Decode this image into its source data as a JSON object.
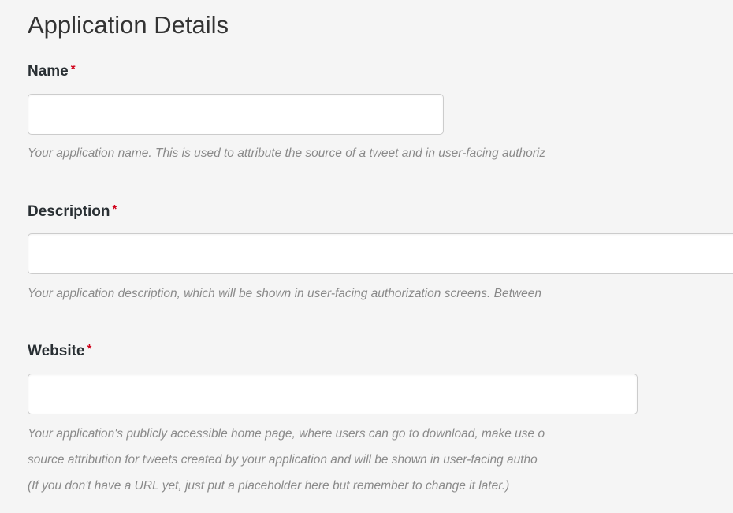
{
  "section": {
    "title": "Application Details"
  },
  "fields": {
    "name": {
      "label": "Name",
      "required_marker": "*",
      "value": "",
      "help": "Your application name. This is used to attribute the source of a tweet and in user-facing authoriz"
    },
    "description": {
      "label": "Description",
      "required_marker": "*",
      "value": "",
      "help": "Your application description, which will be shown in user-facing authorization screens. Between"
    },
    "website": {
      "label": "Website",
      "required_marker": "*",
      "value": "",
      "help_lines": [
        "Your application's publicly accessible home page, where users can go to download, make use o",
        "source attribution for tweets created by your application and will be shown in user-facing autho",
        "(If you don't have a URL yet, just put a placeholder here but remember to change it later.)"
      ]
    }
  },
  "colors": {
    "background": "#f5f5f5",
    "required": "#d0021b",
    "help_text": "#8a8a8a",
    "input_border": "#cccccc"
  }
}
